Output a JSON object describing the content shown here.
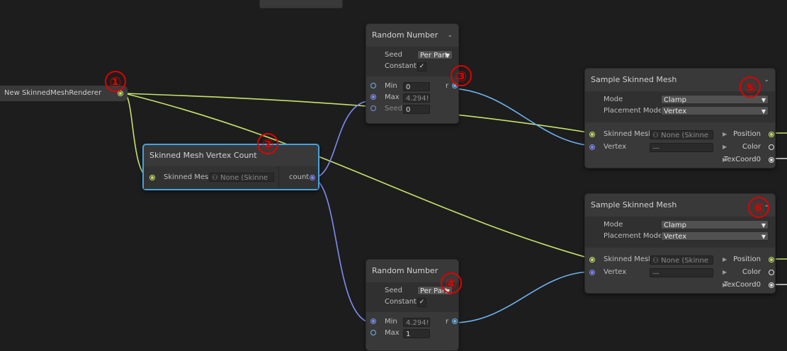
{
  "context": {
    "label": "New SkinnedMeshRenderer"
  },
  "vertex_count": {
    "title": "Skinned Mesh Vertex Count",
    "input_label": "Skinned Mesh",
    "input_value": "None (Skinne",
    "output_label": "count"
  },
  "random_top": {
    "title": "Random Number",
    "seed_label": "Seed",
    "seed_value": "Per Part",
    "constant_label": "Constant",
    "constant_check": "✓",
    "min_label": "Min",
    "min_value": "0",
    "max_label": "Max",
    "max_value": "4.294!",
    "seed_in_label": "Seed",
    "seed_in_value": "0",
    "output_label": "r"
  },
  "random_bottom": {
    "title": "Random Number",
    "seed_label": "Seed",
    "seed_value": "Per Part",
    "constant_label": "Constant",
    "constant_check": "✓",
    "min_label": "Min",
    "min_value": "4.294!",
    "max_label": "Max",
    "max_value": "1",
    "output_label": "r"
  },
  "sample_top": {
    "title": "Sample Skinned Mesh",
    "mode_label": "Mode",
    "mode_value": "Clamp",
    "placement_label": "Placement Mode",
    "placement_value": "Vertex",
    "mesh_label": "Skinned Mesh",
    "mesh_value": "None (Skinne",
    "vertex_label": "Vertex",
    "vertex_value": "—",
    "out_position": "Position",
    "out_color": "Color",
    "out_texcoord": "TexCoord0"
  },
  "sample_bottom": {
    "title": "Sample Skinned Mesh",
    "mode_label": "Mode",
    "mode_value": "Clamp",
    "placement_label": "Placement Mode",
    "placement_value": "Vertex",
    "mesh_label": "Skinned Mesh",
    "mesh_value": "None (Skinne",
    "vertex_label": "Vertex",
    "vertex_value": "—",
    "out_position": "Position",
    "out_color": "Color",
    "out_texcoord": "TexCoord0"
  },
  "annotations": [
    "①",
    "②",
    "③",
    "④",
    "⑤",
    "⑥"
  ],
  "colors": {
    "background": "#1d1d1d",
    "node": "#393939",
    "selection": "#44a3e0",
    "wire_mesh": "#c7e26b",
    "wire_uint": "#7f8cf0",
    "wire_float": "#6fb3f0",
    "annotation": "#e00000"
  }
}
